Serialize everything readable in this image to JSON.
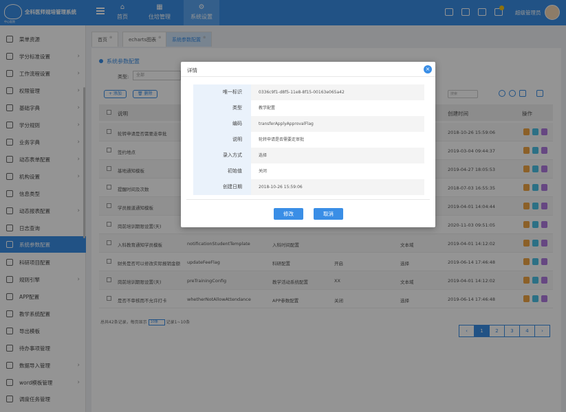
{
  "header": {
    "logo_text": "全科医师规培管理系统",
    "logo_sub": "中心医院",
    "nav": [
      {
        "label": "首页",
        "icon": "home-icon"
      },
      {
        "label": "住培管理",
        "icon": "building-icon"
      },
      {
        "label": "系统设置",
        "icon": "settings-icon"
      }
    ],
    "user_name": "超级管理员"
  },
  "sidebar": {
    "items": [
      {
        "label": "菜单资源",
        "arrow": ""
      },
      {
        "label": "学分标准设置",
        "arrow": "›"
      },
      {
        "label": "工作流程设置",
        "arrow": "›"
      },
      {
        "label": "权限管理",
        "arrow": "›"
      },
      {
        "label": "基础字典",
        "arrow": "›"
      },
      {
        "label": "学分规则",
        "arrow": "›"
      },
      {
        "label": "业务字典",
        "arrow": "›"
      },
      {
        "label": "动态表单配置",
        "arrow": "›"
      },
      {
        "label": "机构设置",
        "arrow": "›"
      },
      {
        "label": "信息类型",
        "arrow": ""
      },
      {
        "label": "动态报表配置",
        "arrow": "›"
      },
      {
        "label": "日志查询",
        "arrow": ""
      },
      {
        "label": "系统参数配置",
        "arrow": ""
      },
      {
        "label": "科研项目配置",
        "arrow": ""
      },
      {
        "label": "规则引擎",
        "arrow": "›"
      },
      {
        "label": "APP配置",
        "arrow": ""
      },
      {
        "label": "教学系统配置",
        "arrow": ""
      },
      {
        "label": "导出模板",
        "arrow": ""
      },
      {
        "label": "待办事项管理",
        "arrow": ""
      },
      {
        "label": "数据导入管理",
        "arrow": "›"
      },
      {
        "label": "word模板管理",
        "arrow": "›"
      },
      {
        "label": "调度任务管理",
        "arrow": ""
      }
    ]
  },
  "tabs": [
    {
      "label": "首页"
    },
    {
      "label": "echarts图表"
    },
    {
      "label": "系统参数配置"
    }
  ],
  "panel": {
    "title": "系统参数配置",
    "filter_label": "类型:",
    "filter_value": "全部",
    "add_label": "+ 添加",
    "delete_label": "删除",
    "search_placeholder": "搜索"
  },
  "table": {
    "headers": {
      "desc": "说明",
      "created": "创建时间",
      "ops": "操作"
    },
    "rows": [
      {
        "desc": "轮转申请是否需要走审批",
        "code": "",
        "type": "",
        "val": "",
        "mode": "",
        "time": "2018-10-26 15:59:06"
      },
      {
        "desc": "签约地点",
        "code": "",
        "type": "",
        "val": "",
        "mode": "",
        "time": "2019-03-04 09:44:37"
      },
      {
        "desc": "基地通知模板",
        "code": "",
        "type": "",
        "val": "",
        "mode": "",
        "time": "2019-04-27 18:05:53"
      },
      {
        "desc": "提醒时间及次数",
        "code": "",
        "type": "",
        "val": "",
        "mode": "",
        "time": "2018-07-03 16:55:35"
      },
      {
        "desc": "学员报道通知模板",
        "code": "",
        "type": "",
        "val": "",
        "mode": "",
        "time": "2019-04-01 14:04:44"
      },
      {
        "desc": "岗前培训期限设置(天)",
        "code": "",
        "type": "",
        "val": "",
        "mode": "",
        "time": "2020-11-03 09:51:05"
      },
      {
        "desc": "入科教育通知学员模板",
        "code": "notificationStudentTemplate",
        "type": "入科时间配置",
        "val": "",
        "mode": "文本域",
        "time": "2019-04-01 14:12:02"
      },
      {
        "desc": "财务是否可以修改实际报销金额",
        "code": "updateFeeFlag",
        "type": "科研配置",
        "val": "开启",
        "mode": "选择",
        "time": "2019-06-14 17:46:48"
      },
      {
        "desc": "岗前培训期限设置(天)",
        "code": "preTrainingConfig",
        "type": "教学活动系统配置",
        "val": "XX",
        "mode": "文本域",
        "time": "2019-04-01 14:12:02"
      },
      {
        "desc": "是否不审核而不允许打卡",
        "code": "whetherNotAllowAttendance",
        "type": "APP参数配置",
        "val": "关闭",
        "mode": "选择",
        "time": "2019-06-14 17:46:48"
      }
    ]
  },
  "pager": {
    "text_prefix": "总共42条记录，每页显示",
    "page_size": "10条",
    "text_suffix": "记录1~10条",
    "prev": "‹",
    "pages": [
      "1",
      "2",
      "3",
      "4"
    ],
    "next": "›",
    "current": "1"
  },
  "modal": {
    "title": "详情",
    "close": "×",
    "fields": [
      {
        "label": "唯一标识",
        "value": "0336c9f1-d8f5-11e8-8f15-00163e065a42"
      },
      {
        "label": "类型",
        "value": "教学配置"
      },
      {
        "label": "编码",
        "value": "transferApplyApprovalFlag"
      },
      {
        "label": "说明",
        "value": "轮转申请是否需要走审批"
      },
      {
        "label": "录入方式",
        "value": "选择"
      },
      {
        "label": "初始值",
        "value": "关闭"
      },
      {
        "label": "创建日期",
        "value": "2018-10-26 15:59:06"
      }
    ],
    "edit_label": "修改",
    "cancel_label": "取消"
  },
  "colors": {
    "primary": "#3a8ee6",
    "overlay": "rgba(0,0,0,0.42)"
  }
}
